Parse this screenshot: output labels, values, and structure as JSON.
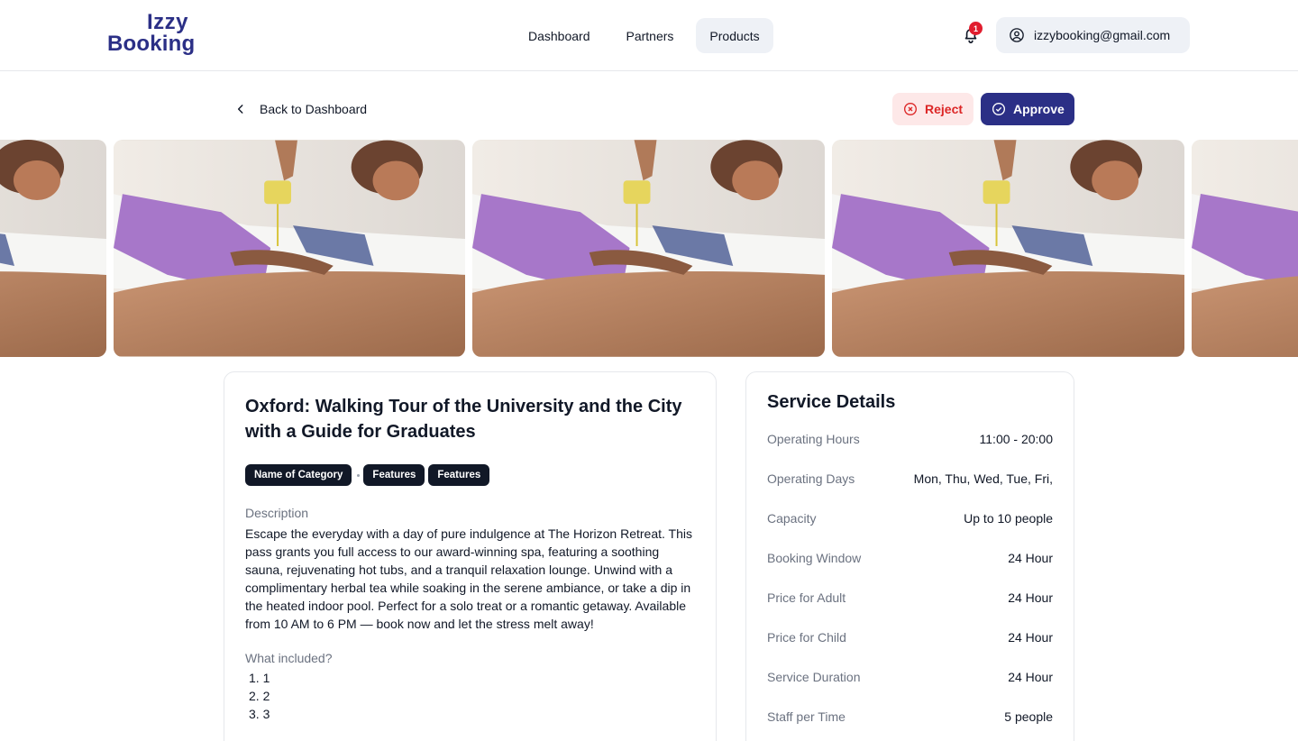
{
  "brand": {
    "line1": "Izzy",
    "line2": "Booking",
    "color": "#2b2f86"
  },
  "nav": [
    {
      "label": "Dashboard",
      "active": false
    },
    {
      "label": "Partners",
      "active": false
    },
    {
      "label": "Products",
      "active": true
    }
  ],
  "notifications": {
    "icon": "bell-icon",
    "count": "1"
  },
  "account": {
    "icon": "user-circle-icon",
    "email": "izzybooking@gmail.com"
  },
  "actions": {
    "back_label": "Back to Dashboard",
    "reject_label": "Reject",
    "approve_label": "Approve",
    "reject_color": "#dc2626",
    "approve_color": "#2b2f86"
  },
  "product": {
    "title": "Oxford: Walking Tour of the University and the City with a Guide for Graduates",
    "tags": [
      "Name of Category",
      "Features",
      "Features"
    ],
    "description_label": "Description",
    "description": "Escape the everyday with a day of pure indulgence at The Horizon Retreat. This pass grants you full access to our award-winning spa, featuring a soothing sauna, rejuvenating hot tubs, and a tranquil relaxation lounge. Unwind with a complimentary herbal tea while soaking in the serene ambiance, or take a dip in the heated indoor pool. Perfect for a solo treat or a romantic getaway. Available from 10 AM to 6 PM — book now and let the stress melt away!",
    "included_label": "What included?",
    "included": [
      "1. 1",
      "2. 2",
      "3. 3"
    ]
  },
  "service_details": {
    "title": "Service Details",
    "rows": [
      {
        "label": "Operating Hours",
        "value": "11:00 - 20:00"
      },
      {
        "label": "Operating Days",
        "value": "Mon, Thu, Wed, Tue, Fri,"
      },
      {
        "label": "Capacity",
        "value": "Up to 10 people"
      },
      {
        "label": "Booking Window",
        "value": "24 Hour"
      },
      {
        "label": "Price for Adult",
        "value": "24 Hour"
      },
      {
        "label": "Price for Child",
        "value": "24 Hour"
      },
      {
        "label": "Service Duration",
        "value": "24 Hour"
      },
      {
        "label": "Staff per Time",
        "value": "5 people"
      }
    ]
  }
}
